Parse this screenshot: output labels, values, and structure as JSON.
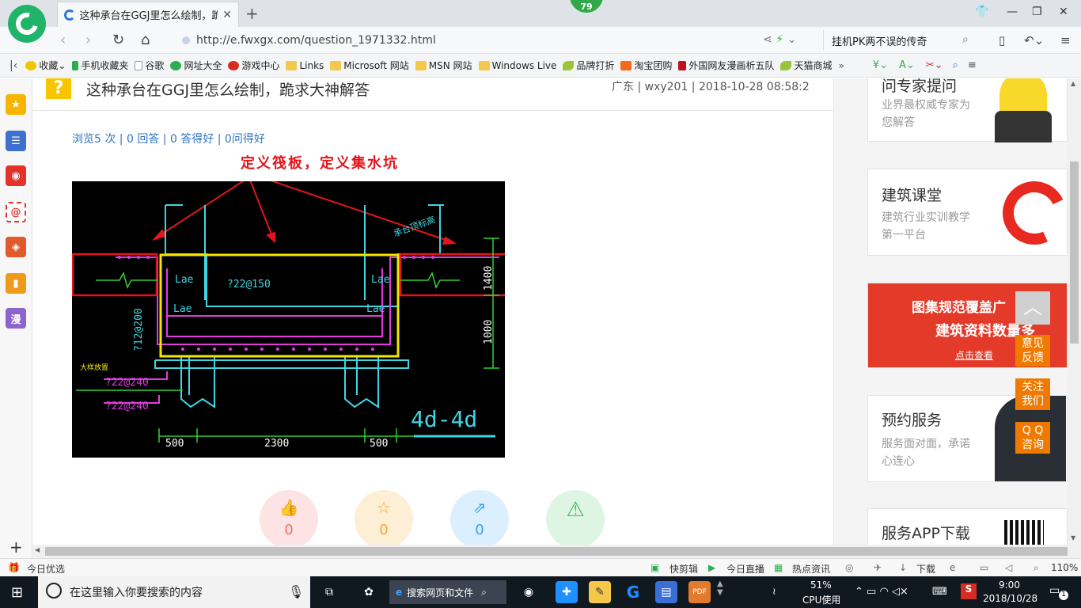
{
  "browser": {
    "badge": "79",
    "tab_title": "这种承台在GGJ里怎么绘制，跪求",
    "url": "http://e.fwxgx.com/question_1971332.html",
    "search_text": "挂机PK两不误的传奇"
  },
  "bookmarks": [
    {
      "label": "收藏",
      "icon": "star-icon"
    },
    {
      "label": "手机收藏夹",
      "icon": "phone-icon"
    },
    {
      "label": "谷歌",
      "icon": "page-icon"
    },
    {
      "label": "网址大全",
      "icon": "globe-icon"
    },
    {
      "label": "游戏中心",
      "icon": "game-icon"
    },
    {
      "label": "Links",
      "icon": "folder-icon"
    },
    {
      "label": "Microsoft 网站",
      "icon": "folder-icon"
    },
    {
      "label": "MSN 网站",
      "icon": "folder-icon"
    },
    {
      "label": "Windows Live",
      "icon": "folder-icon"
    },
    {
      "label": "品牌打折",
      "icon": "leaf-icon"
    },
    {
      "label": "淘宝团购",
      "icon": "taobao-icon"
    },
    {
      "label": "外国网友漫画析五队",
      "icon": "red-icon"
    },
    {
      "label": "天猫商城",
      "icon": "leaf-icon"
    }
  ],
  "sidebar": {
    "icons": [
      "favorites-icon",
      "news-icon",
      "weibo-icon",
      "mail-icon",
      "game-icon",
      "book-icon",
      "comic-icon"
    ],
    "comic_label": "漫",
    "add": "+"
  },
  "question": {
    "title": "这种承台在GGJ里怎么绘制，跪求大神解答",
    "meta": "广东 | wxy201 | 2018-10-28 08:58:2",
    "stats": "浏览5 次 | 0 回答 | 0 答得好 | 0问得好",
    "annotation": "定义筏板，定义集水坑"
  },
  "drawing": {
    "labels": [
      "Lae",
      "Lae",
      "Lae",
      "Lae",
      "?22@150",
      "?12@200",
      "?22@240",
      "?22@240",
      "1400",
      "1000",
      "500",
      "2300",
      "500",
      "4d-4d",
      "承台顶标高",
      "大样放置"
    ]
  },
  "actions": [
    {
      "name": "like-button",
      "icon": "thumbs-up-icon",
      "value": "0"
    },
    {
      "name": "favorite-button",
      "icon": "star-icon",
      "value": "0"
    },
    {
      "name": "share-button",
      "icon": "share-icon",
      "value": "0"
    },
    {
      "name": "report-button",
      "icon": "warning-icon",
      "value": ""
    }
  ],
  "right": {
    "expert": {
      "title": "问专家提问",
      "sub": "业界最权威专家为您解答"
    },
    "class": {
      "title": "建筑课堂",
      "sub": "建筑行业实训教学第一平台"
    },
    "banner": {
      "line1": "图集规范覆盖广",
      "line2": "建筑资料数量多",
      "button": "点击查看"
    },
    "service": {
      "title": "预约服务",
      "sub": "服务面对面，承诺心连心"
    },
    "app": {
      "title": "服务APP下载"
    },
    "floats": [
      "意见\n反馈",
      "关注\n我们",
      "Q Q\n咨询"
    ]
  },
  "statusbar": {
    "left": "今日优选",
    "items": [
      "快剪辑",
      "今日直播",
      "热点资讯",
      "下载",
      "110%"
    ]
  },
  "taskbar": {
    "search_placeholder": "在这里输入你要搜索的内容",
    "web_search": "搜索网页和文件",
    "cpu_percent": "51%",
    "cpu_label": "CPU使用",
    "time": "9:00",
    "date": "2018/10/28",
    "notifications": "1"
  }
}
